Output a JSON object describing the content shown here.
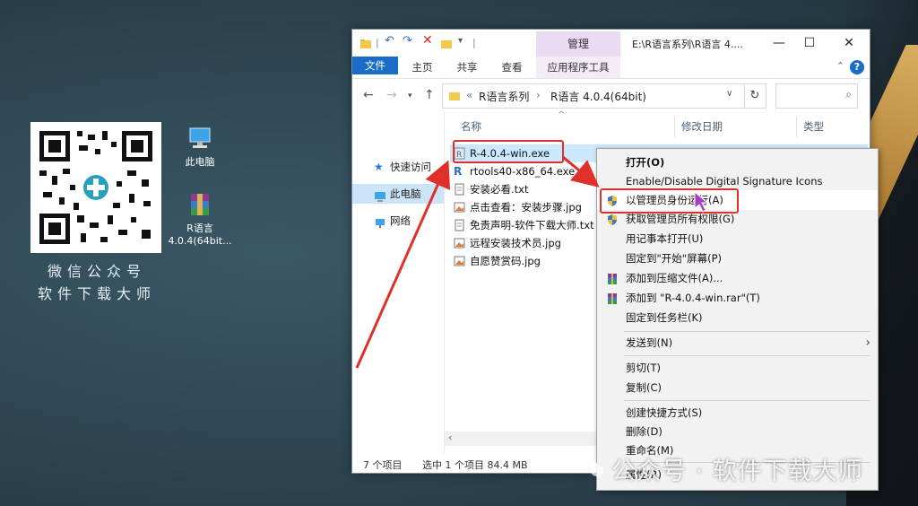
{
  "desktop": {
    "qr_caption_line1": "微信公众号",
    "qr_caption_line2": "软件下载大师",
    "icon_pc_label": "此电脑",
    "icon_r_label_line1": "R语言",
    "icon_r_label_line2": "4.0.4(64bit..."
  },
  "window": {
    "title_path": "E:\\R语言系列\\R语言 4....",
    "manage_tab": "管理",
    "ribbon_tabs": [
      "文件",
      "主页",
      "共享",
      "查看"
    ],
    "app_tools_tab": "应用程序工具",
    "address": {
      "prefix": "«",
      "crumb1": "R语言系列",
      "crumb2": "R语言 4.0.4(64bit)"
    },
    "nav_pane": [
      "快速访问",
      "此电脑",
      "网络"
    ],
    "columns": {
      "name": "名称",
      "date": "修改日期",
      "type": "类型"
    },
    "files": [
      "R-4.0.4-win.exe",
      "rtools40-x86_64.exe",
      "安装必看.txt",
      "点击查看：安装步骤.jpg",
      "免责声明-软件下载大师.txt",
      "远程安装技术员.jpg",
      "自愿赞赏码.jpg"
    ],
    "status": {
      "count": "7 个项目",
      "selected": "选中 1 个项目  84.4 MB"
    }
  },
  "context_menu": {
    "items": [
      "打开(O)",
      "Enable/Disable Digital Signature Icons",
      "以管理员身份运行(A)",
      "获取管理员所有权限(G)",
      "用记事本打开(U)",
      "固定到\"开始\"屏幕(P)",
      "添加到压缩文件(A)...",
      "添加到 \"R-4.0.4-win.rar\"(T)",
      "固定到任务栏(K)",
      "发送到(N)",
      "剪切(T)",
      "复制(C)",
      "创建快捷方式(S)",
      "删除(D)",
      "重命名(M)",
      "属性(R)"
    ]
  },
  "watermark": "公众号 · 软件下载大师",
  "colors": {
    "accent": "#1a6cc7",
    "annotation": "#e0302a",
    "selection": "#cce8ff"
  }
}
